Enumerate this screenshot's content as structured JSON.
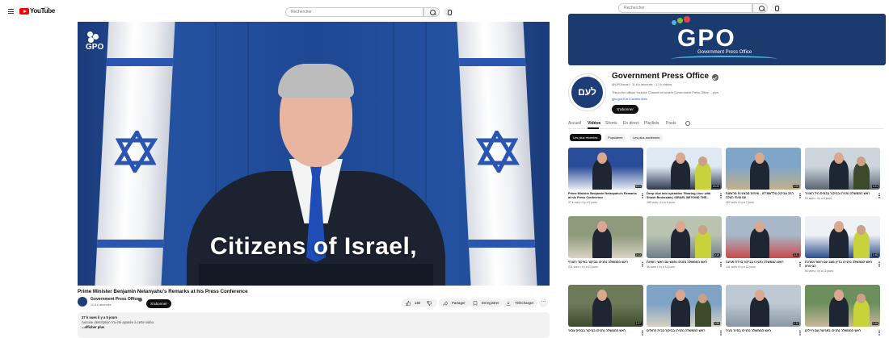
{
  "left": {
    "logo_text": "YouTube",
    "logo_sup": "FR",
    "search_placeholder": "Rechercher",
    "video": {
      "caption": "Citizens of Israel,",
      "watermark": "GPO"
    },
    "title": "Prime Minister Benjamin Netanyahu's Remarks at his Press Conference",
    "channel": {
      "name": "Government Press Office",
      "subs": "11,6 k abonnés",
      "subscribe_label": "S'abonner"
    },
    "actions": {
      "likes": "182",
      "share": "Partager",
      "save": "Enregistrer",
      "download": "Télécharger"
    },
    "description": {
      "stats": "37 k vues  il y a 5 jours",
      "text": "Aucune description n'a été ajoutée à cette vidéo.",
      "more": "...afficher plus"
    }
  },
  "right": {
    "search_placeholder": "Rechercher",
    "banner": {
      "logo": "GPO",
      "sub": "Government Press Office"
    },
    "channel": {
      "avatar_text": "לעם",
      "name": "Government Press Office",
      "handle_line": "@GPOIsrael · 11,6 k abonnés · 1,2 k vidéos",
      "about": "This is the official Youtube Channel of Israel's Government Press Office. ...plus",
      "links": "gpo.gov.il et 4 autres liens",
      "subscribe_label": "S'abonner"
    },
    "tabs": [
      "Accueil",
      "Vidéos",
      "Shorts",
      "En direct",
      "Playlists",
      "Posts"
    ],
    "chips": [
      "Les plus récentes",
      "Populaires",
      "Les plus anciennes"
    ],
    "videos": [
      {
        "title": "Prime Minister Benjamin Netanyahu's Remarks at his Press Conference",
        "meta": "37 k vues • il y a 5 jours",
        "dur": "6:01"
      },
      {
        "title": "Deep dive into operation 'Roaring Lion' with Shosh Bedrosian | ISRAEL BEYOND THE...",
        "meta": "165 vues • il y a 6 jours",
        "dur": "20:22"
      },
      {
        "title": "הרב צביקה גולדשמידט - שיחות מבצעיות מהשטח עם צוותי הצלה",
        "meta": "282 vues • il y a 7 jours",
        "dur": "1:02"
      },
      {
        "title": "ראש הממשלה נתניהו בביקור בבסיס חיל האוויר",
        "meta": "93 vues • il y a 8 jours",
        "dur": "1:01"
      },
      {
        "title": "ראש הממשלה נתניהו בביקור בפיקוד העורף",
        "meta": "231 vues • il y a 10 jours",
        "dur": "2:13"
      },
      {
        "title": "ראש הממשלה נתניהו נפגש עם ראשי רשויות",
        "meta": "46 vues • il y a 11 jours",
        "dur": "0:19"
      },
      {
        "title": "ראש הממשלה נתניהו בביקור בזירת פגיעה",
        "meta": "141 vues • il y a 12 jours",
        "dur": "3:21"
      },
      {
        "title": "ראש הממשלה נתניהו בדיון מצב עם ראשי מערכת הביטחון",
        "meta": "84 vues • il y a 13 jours",
        "dur": "1:48"
      },
      {
        "title": "ראש הממשלה נתניהו בביקור בבסיס צבאי",
        "meta": "",
        "dur": "1:07"
      },
      {
        "title": "ראש הממשלה נתניהו בביקור בבית החולים",
        "meta": "",
        "dur": "0:58"
      },
      {
        "title": "ראש הממשלה נתניהו בסיור בעיר",
        "meta": "",
        "dur": "1:12"
      },
      {
        "title": "ראש הממשלה נתניהו בפגישה עם חיילים",
        "meta": "",
        "dur": "0:46"
      }
    ]
  }
}
